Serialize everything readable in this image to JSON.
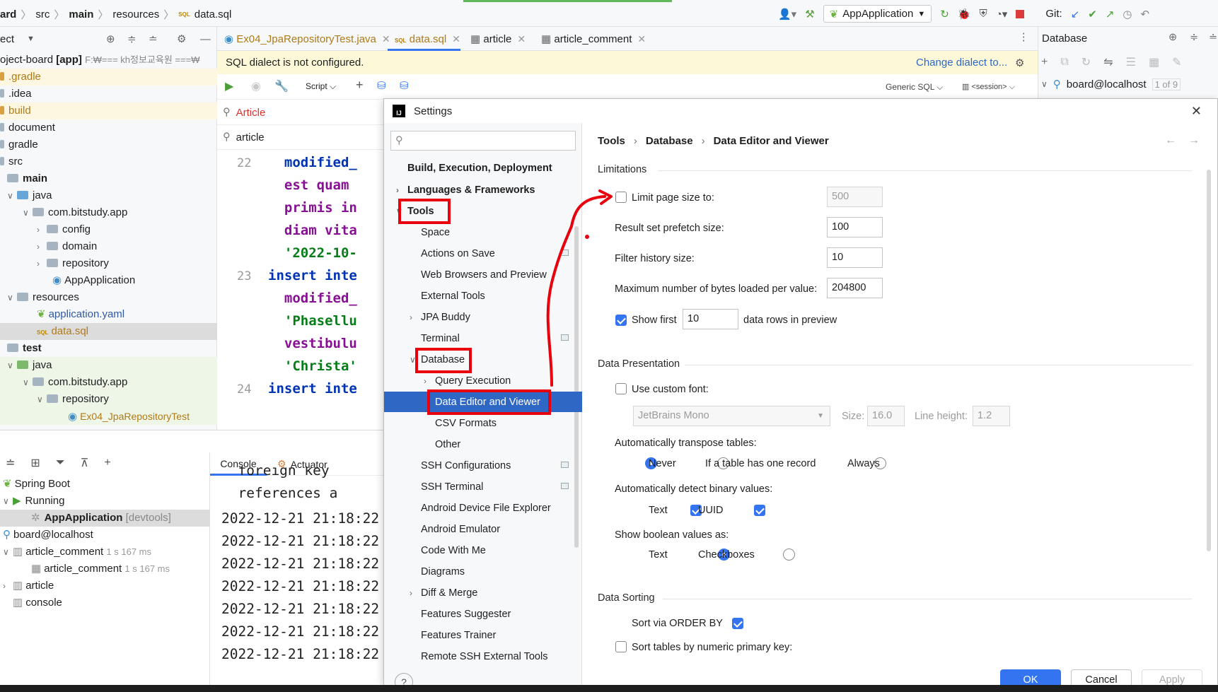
{
  "breadcrumb": {
    "project": "ard",
    "src": "src",
    "main": "main",
    "resources": "resources",
    "file": "data.sql"
  },
  "run_config": {
    "label": "AppApplication",
    "git_label": "Git:"
  },
  "project_panel": {
    "title": "ect",
    "root_label": "oject-board",
    "root_tag": "[app]",
    "root_path": "F:₩=== kh정보교육원 ===₩",
    "items": [
      ".gradle",
      ".idea",
      "build",
      "document",
      "gradle",
      "src",
      "main",
      "java",
      "com.bitstudy.app",
      "config",
      "domain",
      "repository",
      "AppApplication",
      "resources",
      "application.yaml",
      "data.sql",
      "test",
      "java",
      "com.bitstudy.app",
      "repository",
      "Ex04_JpaRepositoryTest"
    ]
  },
  "editor_tabs": [
    {
      "label": "Ex04_JpaRepositoryTest.java"
    },
    {
      "label": "data.sql"
    },
    {
      "label": "article"
    },
    {
      "label": "article_comment"
    }
  ],
  "dialect_banner": {
    "message": "SQL dialect is not configured.",
    "action": "Change dialect to..."
  },
  "editor_toolbar": {
    "script": "Script",
    "generic_sql": "Generic SQL",
    "session": "<session>"
  },
  "editor_search": {
    "query1": "Article",
    "query2": "article"
  },
  "code_lines": [
    {
      "num": "22",
      "text": "  modified_"
    },
    {
      "num": "",
      "text": "  est quam "
    },
    {
      "num": "",
      "text": "  primis in"
    },
    {
      "num": "",
      "text": "  diam vita"
    },
    {
      "num": "",
      "text": "  '2022-10-"
    },
    {
      "num": "23",
      "text": "insert inte"
    },
    {
      "num": "",
      "text": "  modified_"
    },
    {
      "num": "",
      "text": "  'Phasellu"
    },
    {
      "num": "",
      "text": "  vestibulu"
    },
    {
      "num": "",
      "text": "  'Christa'"
    },
    {
      "num": "24",
      "text": "insert inte"
    }
  ],
  "database_panel": {
    "title": "Database",
    "connection": "board@localhost",
    "count": "1 of 9"
  },
  "services": {
    "items": [
      "Spring Boot",
      "Running",
      "AppApplication",
      "[devtools]",
      "board@localhost",
      "article_comment",
      "1 s 167 ms",
      "article_comment",
      "1 s 167 ms",
      "article",
      "console"
    ]
  },
  "console_tabs": {
    "console": "Console",
    "actuator": "Actuator"
  },
  "console_lines": [
    "  foreign key",
    "  references a",
    "2022-12-21 21:18:22",
    "2022-12-21 21:18:22",
    "2022-12-21 21:18:22",
    "2022-12-21 21:18:22",
    "2022-12-21 21:18:22",
    "2022-12-21 21:18:22",
    "2022-12-21 21:18:22"
  ],
  "settings": {
    "title": "Settings",
    "search_placeholder": "",
    "nav": [
      "Build, Execution, Deployment",
      "Languages & Frameworks",
      "Tools",
      "Space",
      "Actions on Save",
      "Web Browsers and Preview",
      "External Tools",
      "JPA Buddy",
      "Terminal",
      "Database",
      "Query Execution",
      "Data Editor and Viewer",
      "CSV Formats",
      "Other",
      "SSH Configurations",
      "SSH Terminal",
      "Android Device File Explorer",
      "Android Emulator",
      "Code With Me",
      "Diagrams",
      "Diff & Merge",
      "Features Suggester",
      "Features Trainer",
      "Remote SSH External Tools"
    ],
    "breadcrumb": [
      "Tools",
      "Database",
      "Data Editor and Viewer"
    ],
    "limitations": {
      "title": "Limitations",
      "limit_page_label": "Limit page size to:",
      "limit_page_value": "500",
      "prefetch_label": "Result set prefetch size:",
      "prefetch_value": "100",
      "filter_label": "Filter history size:",
      "filter_value": "10",
      "maxbytes_label": "Maximum number of bytes loaded per value:",
      "maxbytes_value": "204800",
      "show_first_label": "Show first",
      "show_first_value": "10",
      "rows_label": "data rows in preview"
    },
    "presentation": {
      "title": "Data Presentation",
      "custom_font": "Use custom font:",
      "font": "JetBrains Mono",
      "size_label": "Size:",
      "size_value": "16.0",
      "lh_label": "Line height:",
      "lh_value": "1.2",
      "transpose_label": "Automatically transpose tables:",
      "transpose_opts": [
        "Never",
        "If a table has one record",
        "Always"
      ],
      "binary_label": "Automatically detect binary values:",
      "binary_opts": [
        "Text",
        "UUID"
      ],
      "bool_label": "Show boolean values as:",
      "bool_opts": [
        "Text",
        "Checkboxes"
      ]
    },
    "sorting": {
      "title": "Data Sorting",
      "order_by": "Sort via ORDER BY",
      "numeric_pk": "Sort tables by numeric primary key:"
    },
    "buttons": {
      "ok": "OK",
      "cancel": "Cancel",
      "apply": "Apply"
    },
    "help": "?"
  },
  "colors": {
    "accent": "#3574f0",
    "selection": "#2f68c4",
    "annotation": "#e8000d",
    "banner": "#fdf9d8"
  }
}
